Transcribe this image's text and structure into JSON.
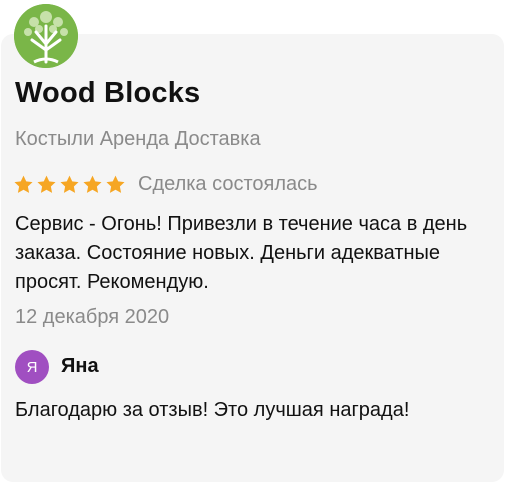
{
  "business": {
    "logo_icon": "tree-logo-icon",
    "name": "Wood Blocks",
    "category": "Костыли Аренда Доставка"
  },
  "review": {
    "rating": 5,
    "rating_max": 5,
    "star_color": "#f6a623",
    "status": "Сделка состоялась",
    "text": "Сервис - Огонь! Привезли в течение часа в день заказа. Состояние новых. Деньги адекватные просят. Рекомендую.",
    "date": "12 декабря 2020"
  },
  "reply": {
    "avatar_letter": "Я",
    "avatar_color": "#a04fc1",
    "name": "Яна",
    "text": "Благодарю за отзыв! Это лучшая награда!"
  }
}
